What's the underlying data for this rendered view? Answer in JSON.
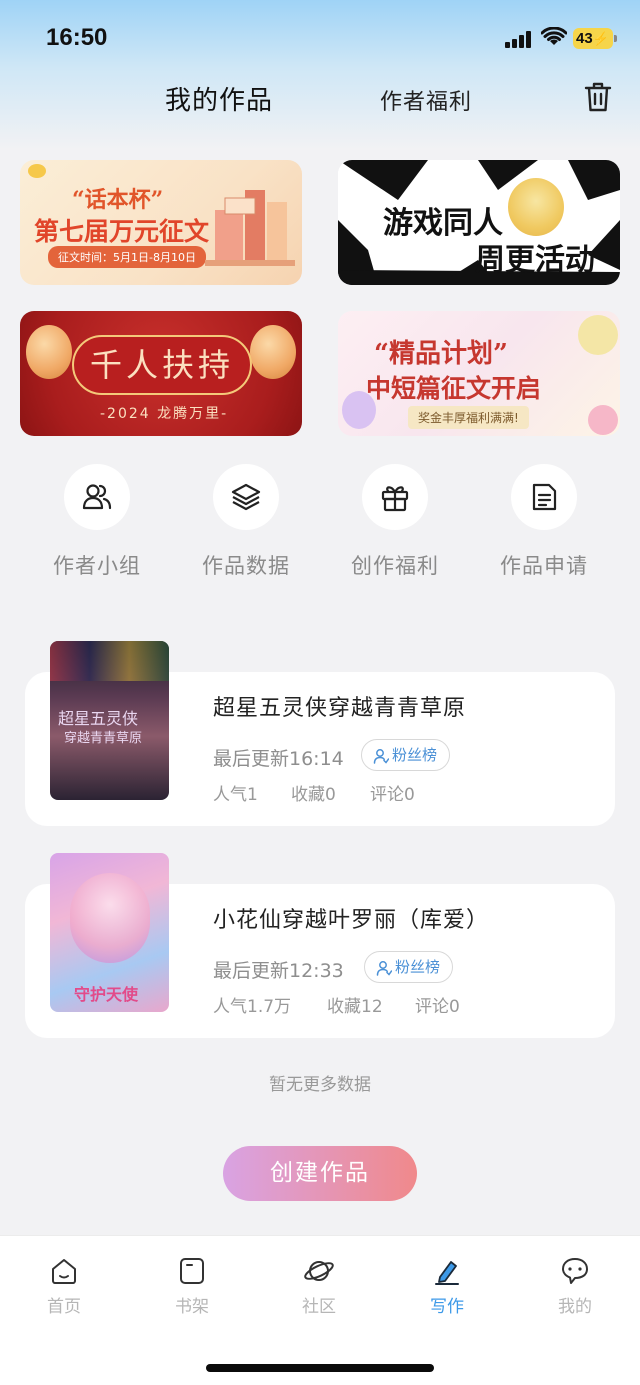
{
  "status_bar": {
    "time": "16:50",
    "battery": "43"
  },
  "header": {
    "tab_my_works": "我的作品",
    "tab_author_benefits": "作者福利"
  },
  "banners": [
    {
      "title_line_1": "“话本杯”",
      "title_line_2": "第七届万元征文",
      "date": "征文时间：5月1日-8月10日"
    },
    {
      "title_line_1": "游戏同人",
      "title_line_2": "周更活动"
    },
    {
      "title": "千人扶持",
      "subtitle": "-2024 龙腾万里-"
    },
    {
      "title_line_1": "“精品计划”",
      "title_line_2": "中短篇征文开启",
      "tag": "奖金丰厚福利满满!"
    }
  ],
  "quick_actions": [
    {
      "label": "作者小组",
      "icon": "people-icon"
    },
    {
      "label": "作品数据",
      "icon": "layers-icon"
    },
    {
      "label": "创作福利",
      "icon": "gift-icon"
    },
    {
      "label": "作品申请",
      "icon": "document-icon"
    }
  ],
  "works": [
    {
      "title": "超星五灵侠穿越青青草原",
      "updated": "最后更新16:14",
      "badge": "粉丝榜",
      "popularity": "人气1",
      "favorites": "收藏0",
      "comments": "评论0",
      "cover_text_1": "超星五灵侠",
      "cover_text_2": "穿越青青草原"
    },
    {
      "title": "小花仙穿越叶罗丽（库爱）",
      "updated": "最后更新12:33",
      "badge": "粉丝榜",
      "popularity": "人气1.7万",
      "favorites": "收藏12",
      "comments": "评论0",
      "cover_text_1": "守护天使"
    }
  ],
  "no_more_text": "暂无更多数据",
  "create_button": "创建作品",
  "tab_bar": [
    {
      "label": "首页",
      "icon": "home-icon",
      "active": false
    },
    {
      "label": "书架",
      "icon": "bookshelf-icon",
      "active": false
    },
    {
      "label": "社区",
      "icon": "planet-icon",
      "active": false
    },
    {
      "label": "写作",
      "icon": "pen-icon",
      "active": true
    },
    {
      "label": "我的",
      "icon": "chat-bubble-icon",
      "active": false
    }
  ],
  "colors": {
    "accent_blue": "#3c99e8",
    "create_gradient_start": "#d9a3e3",
    "create_gradient_end": "#f0898b",
    "badge_blue": "#4a90d6"
  }
}
